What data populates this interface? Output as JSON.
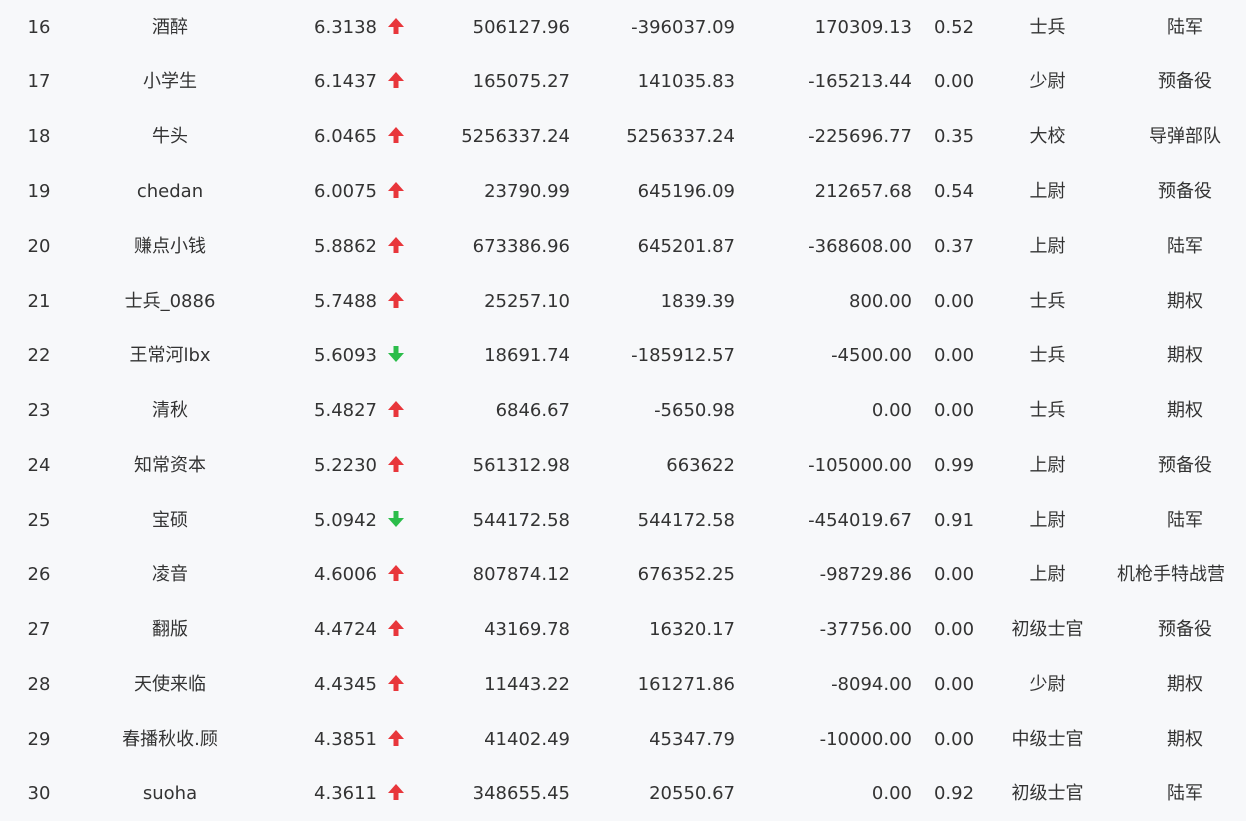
{
  "colors": {
    "up": "#e8363b",
    "down": "#2bbd4a",
    "text": "#333333",
    "background": "#f7f8fa"
  },
  "rows": [
    {
      "rank": "16",
      "name": "酒醉",
      "score": "6.3138",
      "trend": "up",
      "v1": "506127.96",
      "v2": "-396037.09",
      "v3": "170309.13",
      "ratio": "0.52",
      "rank_name": "士兵",
      "group": "陆军"
    },
    {
      "rank": "17",
      "name": "小学生",
      "score": "6.1437",
      "trend": "up",
      "v1": "165075.27",
      "v2": "141035.83",
      "v3": "-165213.44",
      "ratio": "0.00",
      "rank_name": "少尉",
      "group": "预备役"
    },
    {
      "rank": "18",
      "name": "牛头",
      "score": "6.0465",
      "trend": "up",
      "v1": "5256337.24",
      "v2": "5256337.24",
      "v3": "-225696.77",
      "ratio": "0.35",
      "rank_name": "大校",
      "group": "导弹部队"
    },
    {
      "rank": "19",
      "name": "chedan",
      "score": "6.0075",
      "trend": "up",
      "v1": "23790.99",
      "v2": "645196.09",
      "v3": "212657.68",
      "ratio": "0.54",
      "rank_name": "上尉",
      "group": "预备役"
    },
    {
      "rank": "20",
      "name": "赚点小钱",
      "score": "5.8862",
      "trend": "up",
      "v1": "673386.96",
      "v2": "645201.87",
      "v3": "-368608.00",
      "ratio": "0.37",
      "rank_name": "上尉",
      "group": "陆军"
    },
    {
      "rank": "21",
      "name": "士兵_0886",
      "score": "5.7488",
      "trend": "up",
      "v1": "25257.10",
      "v2": "1839.39",
      "v3": "800.00",
      "ratio": "0.00",
      "rank_name": "士兵",
      "group": "期权"
    },
    {
      "rank": "22",
      "name": "王常河lbx",
      "score": "5.6093",
      "trend": "down",
      "v1": "18691.74",
      "v2": "-185912.57",
      "v3": "-4500.00",
      "ratio": "0.00",
      "rank_name": "士兵",
      "group": "期权"
    },
    {
      "rank": "23",
      "name": "清秋",
      "score": "5.4827",
      "trend": "up",
      "v1": "6846.67",
      "v2": "-5650.98",
      "v3": "0.00",
      "ratio": "0.00",
      "rank_name": "士兵",
      "group": "期权"
    },
    {
      "rank": "24",
      "name": "知常资本",
      "score": "5.2230",
      "trend": "up",
      "v1": "561312.98",
      "v2": "663622",
      "v3": "-105000.00",
      "ratio": "0.99",
      "rank_name": "上尉",
      "group": "预备役"
    },
    {
      "rank": "25",
      "name": "宝硕",
      "score": "5.0942",
      "trend": "down",
      "v1": "544172.58",
      "v2": "544172.58",
      "v3": "-454019.67",
      "ratio": "0.91",
      "rank_name": "上尉",
      "group": "陆军"
    },
    {
      "rank": "26",
      "name": "凌音",
      "score": "4.6006",
      "trend": "up",
      "v1": "807874.12",
      "v2": "676352.25",
      "v3": "-98729.86",
      "ratio": "0.00",
      "rank_name": "上尉",
      "group": "机枪手特战营"
    },
    {
      "rank": "27",
      "name": "翻版",
      "score": "4.4724",
      "trend": "up",
      "v1": "43169.78",
      "v2": "16320.17",
      "v3": "-37756.00",
      "ratio": "0.00",
      "rank_name": "初级士官",
      "group": "预备役"
    },
    {
      "rank": "28",
      "name": "天使来临",
      "score": "4.4345",
      "trend": "up",
      "v1": "11443.22",
      "v2": "161271.86",
      "v3": "-8094.00",
      "ratio": "0.00",
      "rank_name": "少尉",
      "group": "期权"
    },
    {
      "rank": "29",
      "name": "春播秋收.顾",
      "score": "4.3851",
      "trend": "up",
      "v1": "41402.49",
      "v2": "45347.79",
      "v3": "-10000.00",
      "ratio": "0.00",
      "rank_name": "中级士官",
      "group": "期权"
    },
    {
      "rank": "30",
      "name": "suoha",
      "score": "4.3611",
      "trend": "up",
      "v1": "348655.45",
      "v2": "20550.67",
      "v3": "0.00",
      "ratio": "0.92",
      "rank_name": "初级士官",
      "group": "陆军"
    }
  ]
}
